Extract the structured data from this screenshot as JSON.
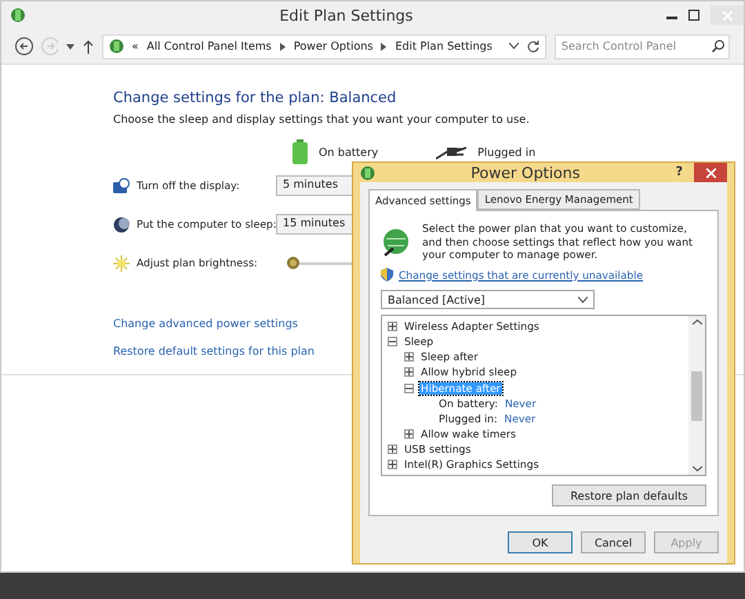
{
  "window": {
    "title": "Edit Plan Settings"
  },
  "address_bar": {
    "overflow": "«",
    "crumbs": [
      "All Control Panel Items",
      "Power Options",
      "Edit Plan Settings"
    ],
    "search_placeholder": "Search Control Panel"
  },
  "plan": {
    "heading": "Change settings for the plan: Balanced",
    "description": "Choose the sleep and display settings that you want your computer to use.",
    "columns": [
      "On battery",
      "Plugged in"
    ],
    "settings": [
      {
        "kind": "dropdown",
        "label": "Turn off the display:",
        "value": "5 minutes"
      },
      {
        "kind": "dropdown",
        "label": "Put the computer to sleep:",
        "value": "15 minutes"
      },
      {
        "kind": "slider",
        "label": "Adjust plan brightness:",
        "level": 0.0
      }
    ],
    "links": [
      "Change advanced power settings",
      "Restore default settings for this plan"
    ]
  },
  "dialog": {
    "title": "Power Options",
    "help": "?",
    "tabs": [
      {
        "label": "Advanced settings",
        "selected": true
      },
      {
        "label": "Lenovo Energy Management",
        "selected": false
      }
    ],
    "intro": "Select the power plan that you want to customize, and then choose settings that reflect how you want your computer to manage power.",
    "unavailable_link": "Change settings that are currently unavailable",
    "plan_select": "Balanced [Active]",
    "tree": [
      {
        "label": "Wireless Adapter Settings",
        "expanded": false,
        "selected": false
      },
      {
        "label": "Sleep",
        "expanded": true,
        "selected": false,
        "children": [
          {
            "label": "Sleep after",
            "expanded": false,
            "selected": false
          },
          {
            "label": "Allow hybrid sleep",
            "expanded": false,
            "selected": false
          },
          {
            "label": "Hibernate after",
            "expanded": true,
            "selected": true,
            "values": [
              {
                "label": "On battery:",
                "value": "Never"
              },
              {
                "label": "Plugged in:",
                "value": "Never"
              }
            ]
          },
          {
            "label": "Allow wake timers",
            "expanded": false,
            "selected": false
          }
        ]
      },
      {
        "label": "USB settings",
        "expanded": false,
        "selected": false
      },
      {
        "label": "Intel(R) Graphics Settings",
        "expanded": false,
        "selected": false
      }
    ],
    "restore_button": "Restore plan defaults",
    "buttons": [
      {
        "label": "OK",
        "disabled": false,
        "default": true
      },
      {
        "label": "Cancel",
        "disabled": false,
        "default": false
      },
      {
        "label": "Apply",
        "disabled": true,
        "default": false
      }
    ]
  }
}
